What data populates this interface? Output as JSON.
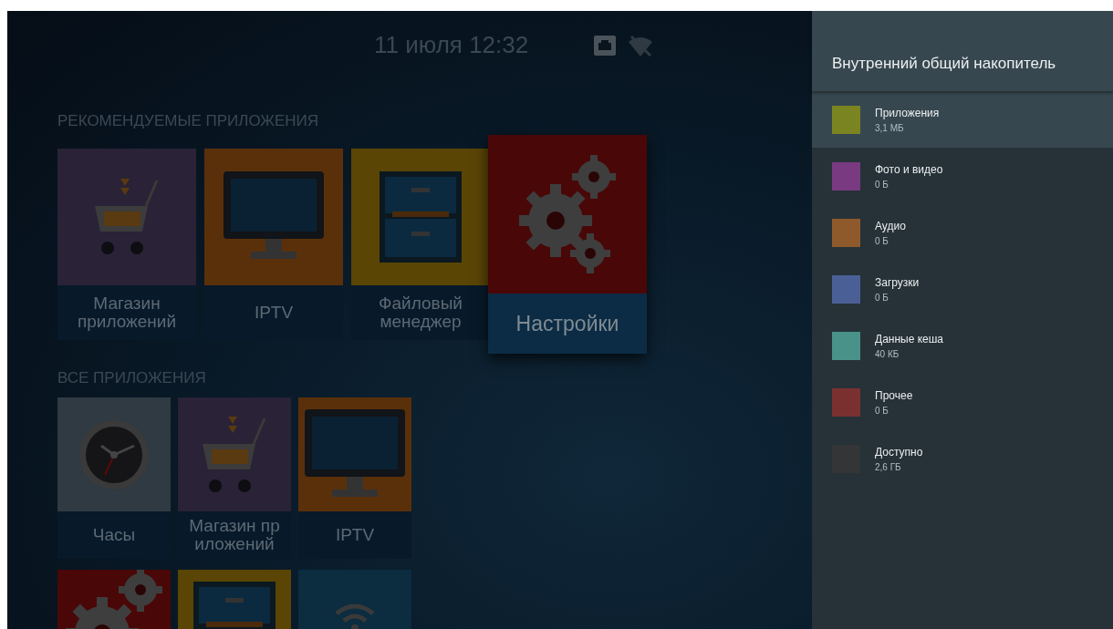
{
  "status_bar": {
    "datetime": "11 июля 12:32",
    "ethernet_connected": true,
    "wifi_off": true
  },
  "recommended": {
    "title": "РЕКОМЕНДУЕМЫЕ ПРИЛОЖЕНИЯ",
    "apps": [
      {
        "label": "Магазин приложений",
        "kind": "cart",
        "selected": false
      },
      {
        "label": "IPTV",
        "kind": "monitor",
        "selected": false
      },
      {
        "label": "Файловый менеджер",
        "kind": "cabinet",
        "selected": false
      },
      {
        "label": "Настройки",
        "kind": "gears",
        "selected": true
      }
    ]
  },
  "all_apps": {
    "title": "ВСЕ ПРИЛОЖЕНИЯ",
    "rows": [
      [
        {
          "label": "Часы",
          "kind": "clock"
        },
        {
          "label": "Магазин пр иложений",
          "kind": "cart"
        },
        {
          "label": "IPTV",
          "kind": "monitor"
        }
      ],
      [
        {
          "kind": "gears"
        },
        {
          "kind": "cabinet"
        },
        {
          "kind": "wifi"
        }
      ]
    ]
  },
  "storage_panel": {
    "title": "Внутренний общий накопитель",
    "items": [
      {
        "name": "Приложения",
        "size": "3,1 МБ",
        "color": "#7a8420",
        "selected": true
      },
      {
        "name": "Фото и видео",
        "size": "0 Б",
        "color": "#7a3a82",
        "selected": false
      },
      {
        "name": "Аудио",
        "size": "0 Б",
        "color": "#8e5a2c",
        "selected": false
      },
      {
        "name": "Загрузки",
        "size": "0 Б",
        "color": "#4a5f95",
        "selected": false
      },
      {
        "name": "Данные кеша",
        "size": "40 КБ",
        "color": "#48928a",
        "selected": false
      },
      {
        "name": "Прочее",
        "size": "0 Б",
        "color": "#7b3030",
        "selected": false
      },
      {
        "name": "Доступно",
        "size": "2,6 ГБ",
        "color": "#333536",
        "selected": false
      }
    ]
  }
}
